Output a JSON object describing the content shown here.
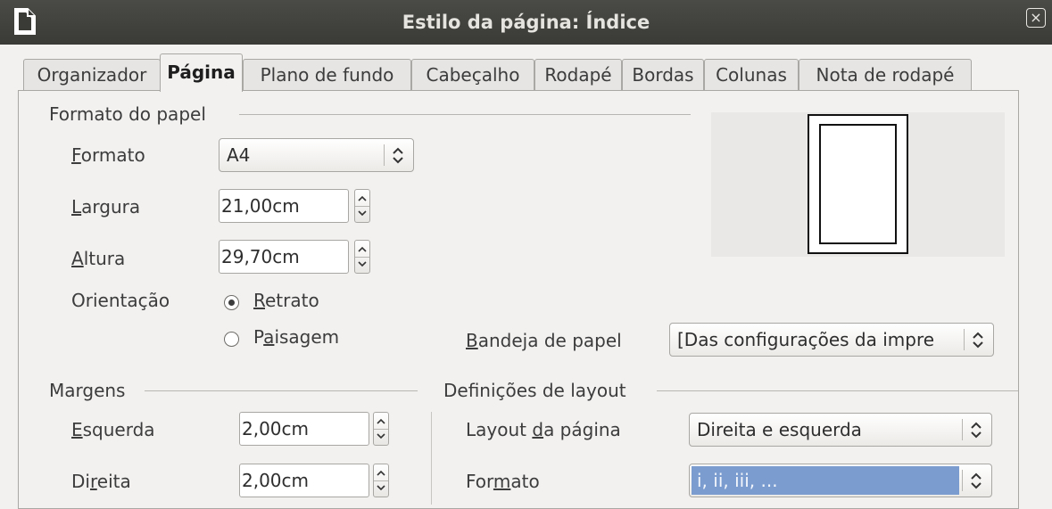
{
  "window": {
    "title": "Estilo da página: Índice",
    "close_glyph": "×"
  },
  "tabs": [
    {
      "label": "Organizador"
    },
    {
      "label": "Página",
      "active": true
    },
    {
      "label": "Plano de fundo"
    },
    {
      "label": "Cabeçalho"
    },
    {
      "label": "Rodapé"
    },
    {
      "label": "Bordas"
    },
    {
      "label": "Colunas"
    },
    {
      "label": "Nota de rodapé"
    }
  ],
  "paper": {
    "section_title": "Formato do papel",
    "format_label_first": "F",
    "format_label_rest": "ormato",
    "format_value": "A4",
    "width_label_first": "L",
    "width_label_rest": "argura",
    "width_value": "21,00cm",
    "height_label_first": "A",
    "height_label_rest": "ltura",
    "height_value": "29,70cm",
    "orientation_label": "Orientação",
    "portrait_first": "R",
    "portrait_rest": "etrato",
    "portrait_selected": true,
    "landscape_pre": "P",
    "landscape_u": "a",
    "landscape_rest": "isagem",
    "tray_label_first": "B",
    "tray_label_rest": "andeja de papel",
    "tray_value": "[Das configurações da impre"
  },
  "margins": {
    "section_title": "Margens",
    "left_label_first": "E",
    "left_label_rest": "squerda",
    "left_value": "2,00cm",
    "right_label_pre": "Di",
    "right_label_u": "r",
    "right_label_rest": "eita",
    "right_value": "2,00cm"
  },
  "layout": {
    "section_title": "Definições de layout",
    "page_layout_pre": "Layout ",
    "page_layout_u": "d",
    "page_layout_rest": "a página",
    "page_layout_value": "Direita e esquerda",
    "format_pre": "For",
    "format_u": "m",
    "format_rest": "ato",
    "format_value": "i, ii, iii, ...",
    "format_highlight": "#7a9ccf"
  },
  "icons": {
    "app": "document-icon",
    "close": "close-icon",
    "combo": "updown-arrows-icon",
    "spin": "spin-arrows-icon"
  }
}
